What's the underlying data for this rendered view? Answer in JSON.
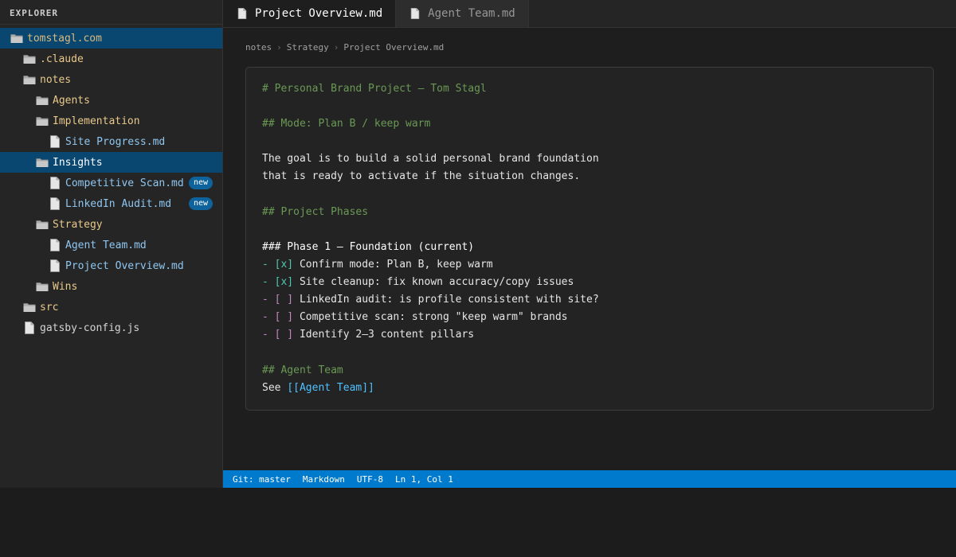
{
  "sidebar": {
    "header": "EXPLORER",
    "items": [
      {
        "label": "tomstagl.com",
        "type": "folder",
        "depth": 0,
        "selected": true,
        "root": true
      },
      {
        "label": ".claude",
        "type": "folder",
        "depth": 1
      },
      {
        "label": "notes",
        "type": "folder",
        "depth": 1
      },
      {
        "label": "Agents",
        "type": "folder",
        "depth": 2
      },
      {
        "label": "Implementation",
        "type": "folder",
        "depth": 2
      },
      {
        "label": "Site Progress.md",
        "type": "file",
        "depth": 3
      },
      {
        "label": "Insights",
        "type": "folder",
        "depth": 2,
        "selected": true
      },
      {
        "label": "Competitive Scan.md",
        "type": "file",
        "depth": 3,
        "badge": "new"
      },
      {
        "label": "LinkedIn Audit.md",
        "type": "file",
        "depth": 3,
        "badge": "new"
      },
      {
        "label": "Strategy",
        "type": "folder",
        "depth": 2
      },
      {
        "label": "Agent Team.md",
        "type": "file",
        "depth": 3
      },
      {
        "label": "Project Overview.md",
        "type": "file",
        "depth": 3
      },
      {
        "label": "Wins",
        "type": "folder",
        "depth": 2
      },
      {
        "label": "src",
        "type": "folder",
        "depth": 1
      },
      {
        "label": "gatsby-config.js",
        "type": "file-plain",
        "depth": 1
      }
    ]
  },
  "tabs": [
    {
      "label": "Project Overview.md",
      "active": true
    },
    {
      "label": "Agent Team.md",
      "active": false
    }
  ],
  "breadcrumb": [
    "notes",
    "Strategy",
    "Project Overview.md"
  ],
  "editor": {
    "lines": [
      {
        "kind": "h",
        "text": "# Personal Brand Project — Tom Stagl"
      },
      {
        "kind": "blank"
      },
      {
        "kind": "h",
        "text": "## Mode: Plan B / keep warm"
      },
      {
        "kind": "blank"
      },
      {
        "kind": "text",
        "text": "The goal is to build a solid personal brand foundation"
      },
      {
        "kind": "text",
        "text": "that is ready to activate if the situation changes."
      },
      {
        "kind": "gap"
      },
      {
        "kind": "h",
        "text": "## Project Phases"
      },
      {
        "kind": "blank"
      },
      {
        "kind": "h3",
        "text": "### Phase 1 — Foundation (current)"
      },
      {
        "kind": "task",
        "done": true,
        "marker": "- [x]",
        "text": " Confirm mode: Plan B, keep warm"
      },
      {
        "kind": "task",
        "done": true,
        "marker": "- [x]",
        "text": " Site cleanup: fix known accuracy/copy issues"
      },
      {
        "kind": "task",
        "done": false,
        "marker": "- [ ]",
        "text": " LinkedIn audit: is profile consistent with site?"
      },
      {
        "kind": "task",
        "done": false,
        "marker": "- [ ]",
        "text": " Competitive scan: strong \"keep warm\" brands"
      },
      {
        "kind": "task",
        "done": false,
        "marker": "- [ ]",
        "text": " Identify 2–3 content pillars"
      },
      {
        "kind": "gap"
      },
      {
        "kind": "h",
        "text": "## Agent Team"
      },
      {
        "kind": "link",
        "prefix": "See ",
        "link": "[[Agent Team]]"
      }
    ]
  },
  "statusbar": {
    "git": "Git: master",
    "language": "Markdown",
    "encoding": "UTF-8",
    "position": "Ln 1, Col 1"
  },
  "colors": {
    "accent": "#007acc",
    "selection": "#094771",
    "heading": "#6a9955",
    "link": "#4fc1ff",
    "folder_label": "#e8c98a",
    "file_label": "#8fc7f0"
  }
}
